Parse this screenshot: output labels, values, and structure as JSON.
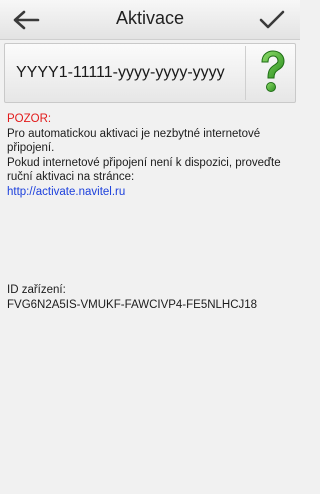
{
  "header": {
    "title": "Aktivace",
    "back_icon": "arrow-left-icon",
    "confirm_icon": "checkmark-icon"
  },
  "key_field": {
    "value": "YYYY1-11111-yyyy-yyyy-yyyy",
    "help_icon": "question-mark-icon",
    "help_color": "#3fae2a"
  },
  "info": {
    "warning_label": "POZOR:",
    "warning_color": "#e21b1b",
    "line1": "Pro automatickou aktivaci je nezbytné internetové připojení.",
    "line2": "Pokud internetové připojení není k dispozici, proveďte ruční aktivaci na stránce:",
    "link": "http://activate.navitel.ru",
    "link_color": "#1b3fdc"
  },
  "device": {
    "label": "ID zařízení:",
    "id": "FVG6N2A5IS-VMUKF-FAWCIVP4-FE5NLHCJ18"
  }
}
